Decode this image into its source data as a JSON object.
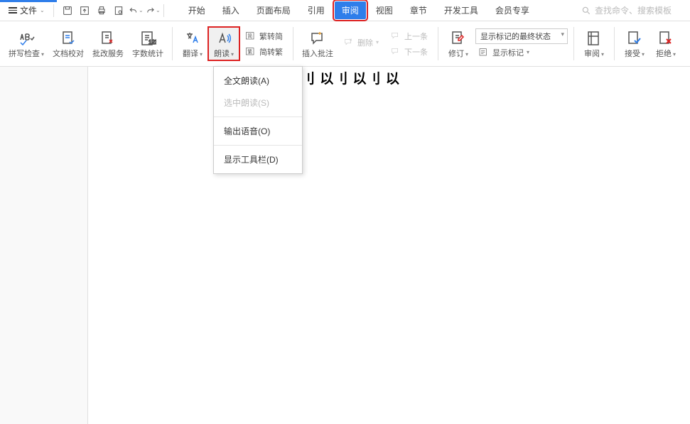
{
  "topbar": {
    "file_label": "文件",
    "search_placeholder": "查找命令、搜索模板"
  },
  "tabs": [
    "开始",
    "插入",
    "页面布局",
    "引用",
    "审阅",
    "视图",
    "章节",
    "开发工具",
    "会员专享"
  ],
  "active_tab_index": 4,
  "ribbon": {
    "spellcheck": {
      "label": "拼写检查"
    },
    "doccheck": {
      "label": "文档校对"
    },
    "revservice": {
      "label": "批改服务"
    },
    "wordcount": {
      "label": "字数统计"
    },
    "translate": {
      "label": "翻译"
    },
    "readaloud": {
      "label": "朗读"
    },
    "trad2simp": {
      "label": "繁转简"
    },
    "simp2trad": {
      "label": "简转繁"
    },
    "insertcomment": {
      "label": "插入批注"
    },
    "delete": {
      "label": "删除"
    },
    "prev": {
      "label": "上一条"
    },
    "next": {
      "label": "下一条"
    },
    "track": {
      "label": "修订"
    },
    "displaymode_value": "显示标记的最终状态",
    "showmarkup": {
      "label": "显示标记"
    },
    "reviewpane": {
      "label": "审阅"
    },
    "accept": {
      "label": "接受"
    },
    "reject": {
      "label": "拒绝"
    }
  },
  "dropdown": {
    "read_all": "全文朗读(A)",
    "read_sel": "选中朗读(S)",
    "output_audio": "输出语音(O)",
    "show_toolbar": "显示工具栏(D)"
  },
  "document": {
    "sample_text": "刂 以刂 以刂 以"
  }
}
